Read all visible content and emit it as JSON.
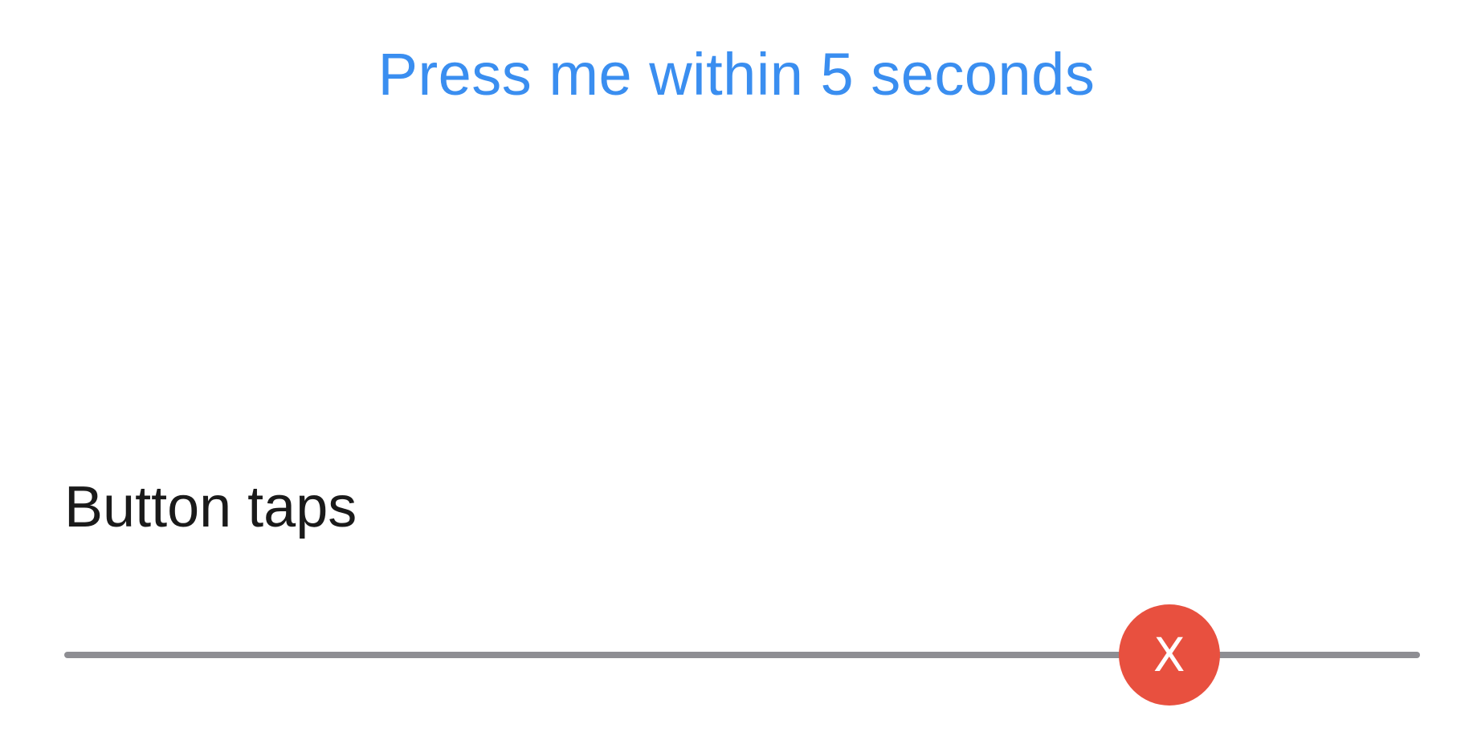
{
  "press_button": {
    "label": "Press me within 5 seconds",
    "color": "#3a8ef0"
  },
  "taps_section": {
    "label": "Button taps"
  },
  "timeline": {
    "color": "#8e8e93",
    "markers": [
      {
        "label": "X",
        "position_fraction": 0.815,
        "color": "#e8503f",
        "state": "miss"
      }
    ]
  }
}
